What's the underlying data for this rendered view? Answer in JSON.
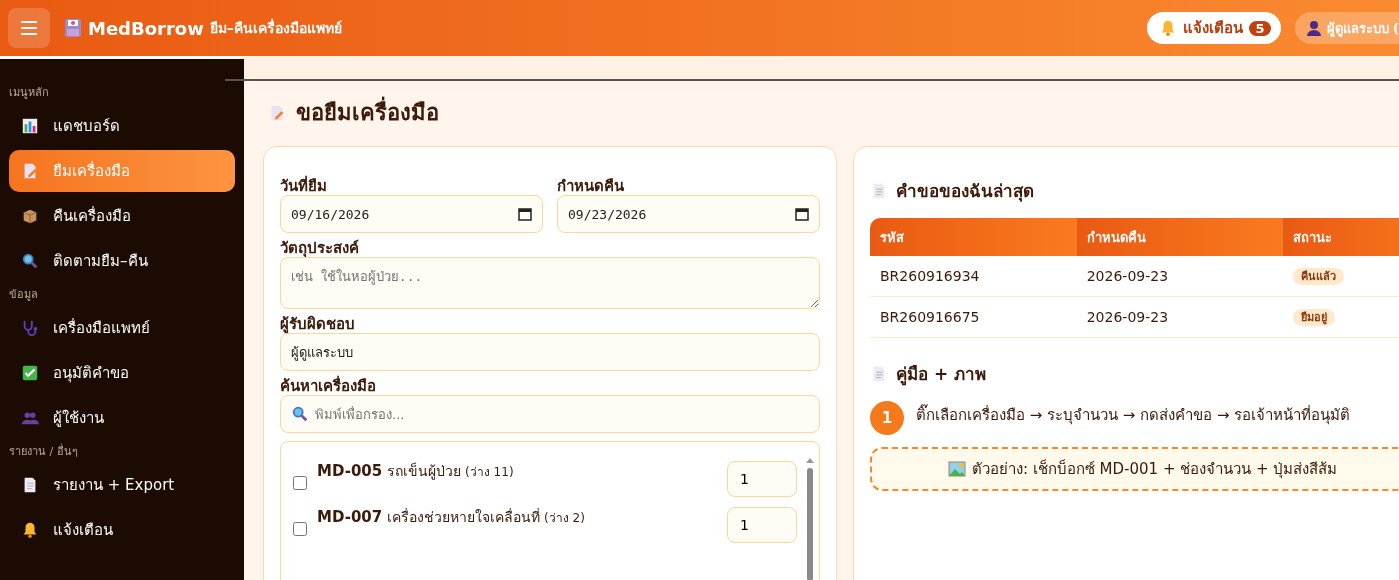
{
  "header": {
    "brand": "MedBorrow",
    "subtitle": "ยืม–คืนเครื่องมือแพทย์",
    "notifications": {
      "label": "แจ้งเตือน",
      "count": "5"
    },
    "user": "ผู้ดูแลระบบ ("
  },
  "sidebar": {
    "sections": [
      {
        "heading": "เมนูหลัก",
        "items": [
          {
            "label": "แดชบอร์ด",
            "selected": false
          },
          {
            "label": "ยืมเครื่องมือ",
            "selected": true
          },
          {
            "label": "คืนเครื่องมือ",
            "selected": false
          },
          {
            "label": "ติดตามยืม–คืน",
            "selected": false
          }
        ]
      },
      {
        "heading": "ข้อมูล",
        "items": [
          {
            "label": "เครื่องมือแพทย์",
            "selected": false
          },
          {
            "label": "อนุมัติคำขอ",
            "selected": false
          },
          {
            "label": "ผู้ใช้งาน",
            "selected": false
          }
        ]
      },
      {
        "heading": "รายงาน / อื่นๆ",
        "items": [
          {
            "label": "รายงาน + Export",
            "selected": false
          },
          {
            "label": "แจ้งเตือน",
            "selected": false
          }
        ]
      }
    ]
  },
  "page_title": "ขอยืมเครื่องมือ",
  "form": {
    "borrow_date": {
      "label": "วันที่ยืม",
      "value": "09/16/2026"
    },
    "due_date": {
      "label": "กำหนดคืน",
      "value": "09/23/2026"
    },
    "purpose": {
      "label": "วัตถุประสงค์",
      "placeholder": "เช่น ใช้ในหอผู้ป่วย..."
    },
    "responsible": {
      "label": "ผู้รับผิดชอบ",
      "value": "ผู้ดูแลระบบ"
    },
    "search": {
      "label": "ค้นหาเครื่องมือ",
      "placeholder": "พิมพ์เพื่อกรอง..."
    },
    "equipment": [
      {
        "code": "MD-005",
        "name": "รถเข็นผู้ป่วย",
        "available": "(ว่าง 11)",
        "checked": false,
        "quantity": "1"
      },
      {
        "code": "MD-007",
        "name": "เครื่องช่วยหายใจเคลื่อนที่",
        "available": "(ว่าง 2)",
        "checked": false,
        "quantity": "1"
      }
    ]
  },
  "recent_requests": {
    "title": "คำขอของฉันล่าสุด",
    "columns": [
      "รหัส",
      "กำหนดคืน",
      "สถานะ"
    ],
    "rows": [
      {
        "code": "BR260916934",
        "due": "2026-09-23",
        "status": "คืนแล้ว"
      },
      {
        "code": "BR260916675",
        "due": "2026-09-23",
        "status": "ยืมอยู่"
      }
    ]
  },
  "guide": {
    "title": "คู่มือ + ภาพ",
    "steps": [
      {
        "number": "1",
        "text": "ติ๊กเลือกเครื่องมือ → ระบุจำนวน → กดส่งคำขอ → รอเจ้าหน้าที่อนุมัติ"
      }
    ],
    "example": "ตัวอย่าง: เช็กบ็อกซ์ MD-001 + ช่องจำนวน + ปุ่มส่งสีส้ม"
  }
}
